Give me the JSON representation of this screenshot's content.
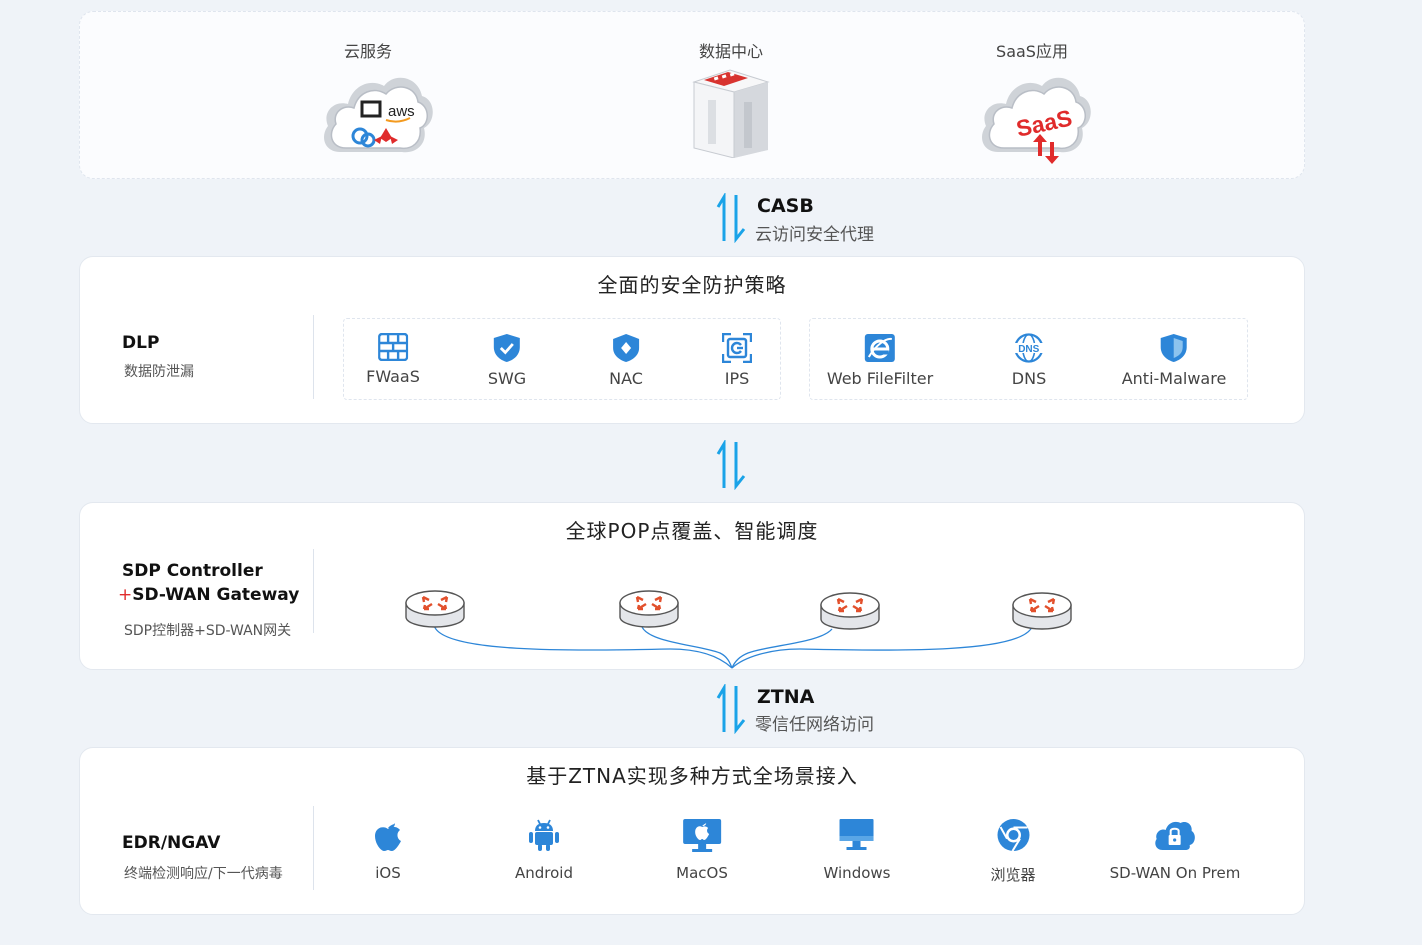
{
  "clouds": [
    {
      "label": "云服务",
      "icon": "cloud-aws-icon",
      "art_text": "aws"
    },
    {
      "label": "数据中心",
      "icon": "datacenter-building-icon"
    },
    {
      "label": "SaaS应用",
      "icon": "cloud-saas-icon",
      "art_text": "SaaS"
    }
  ],
  "casb": {
    "title": "CASB",
    "sub": "云访问安全代理"
  },
  "security": {
    "title": "全面的安全防护策略",
    "side_title": "DLP",
    "side_sub": "数据防泄漏",
    "group1": [
      {
        "label": "FWaaS",
        "icon": "firewall-icon"
      },
      {
        "label": "SWG",
        "icon": "shield-check-icon"
      },
      {
        "label": "NAC",
        "icon": "shield-diamond-icon"
      },
      {
        "label": "IPS",
        "icon": "scan-icon"
      }
    ],
    "group2": [
      {
        "label": "Web FileFilter",
        "icon": "ie-browser-icon"
      },
      {
        "label": "DNS",
        "icon": "dns-globe-icon",
        "art_text": "DNS"
      },
      {
        "label": "Anti-Malware",
        "icon": "shield-icon"
      }
    ]
  },
  "pop": {
    "title": "全球POP点覆盖、智能调度",
    "side_title_line1": "SDP Controller",
    "side_plus": "+",
    "side_title_line2": "SD-WAN Gateway",
    "side_sub": "SDP控制器+SD-WAN网关",
    "router_count": 4,
    "router_icon": "router-icon"
  },
  "ztna": {
    "title": "ZTNA",
    "sub": "零信任网络访问"
  },
  "access": {
    "title": "基于ZTNA实现多种方式全场景接入",
    "side_title": "EDR/NGAV",
    "side_sub": "终端检测响应/下一代病毒",
    "items": [
      {
        "label": "iOS",
        "icon": "apple-icon"
      },
      {
        "label": "Android",
        "icon": "android-icon"
      },
      {
        "label": "MacOS",
        "icon": "mac-monitor-icon"
      },
      {
        "label": "Windows",
        "icon": "windows-monitor-icon"
      },
      {
        "label": "浏览器",
        "icon": "chrome-browser-icon"
      },
      {
        "label": "SD-WAN On Prem",
        "icon": "cloud-lock-icon"
      }
    ]
  },
  "colors": {
    "accent_blue": "#2d86d8",
    "arrow_blue": "#1aa3e8",
    "brand_red": "#e02b2b",
    "router_red": "#e2502c"
  }
}
